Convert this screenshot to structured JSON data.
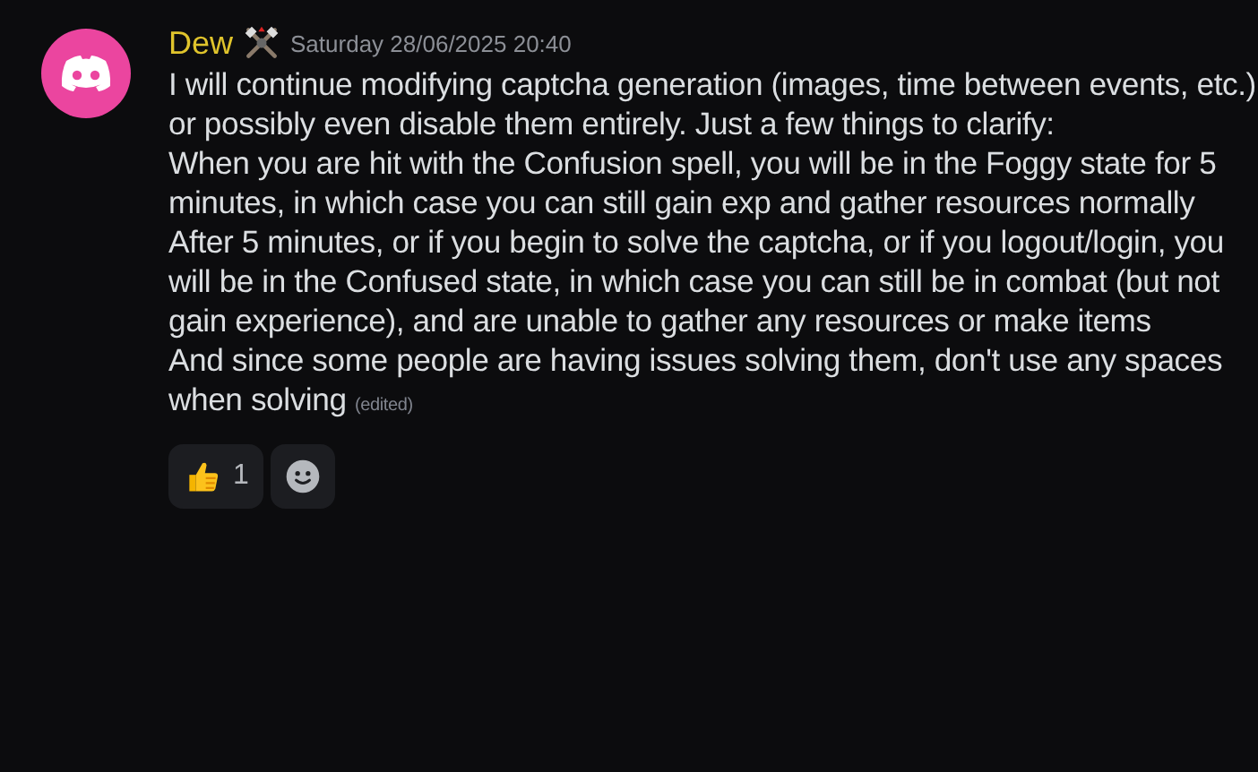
{
  "message": {
    "author": "Dew",
    "timestamp": "Saturday 28/06/2025 20:40",
    "paragraphs": [
      "I will continue modifying captcha generation (images, time between events, etc.) or possibly even disable them entirely. Just a few things to clarify:",
      "When  you are hit with the Confusion spell, you will be in the Foggy state for 5 minutes, in which case you can still gain exp and gather resources normally",
      "After 5 minutes, or if you begin to solve the captcha, or if you logout/login, you will be in the Confused state, in which case you can still be in combat (but not gain experience), and are unable to gather any resources or make items",
      "And since some people are having issues solving them, don't use any spaces when solving"
    ],
    "edited": "(edited)"
  },
  "reactions": [
    {
      "kind": "thumbs-up",
      "count": "1"
    },
    {
      "kind": "add-reaction"
    }
  ]
}
